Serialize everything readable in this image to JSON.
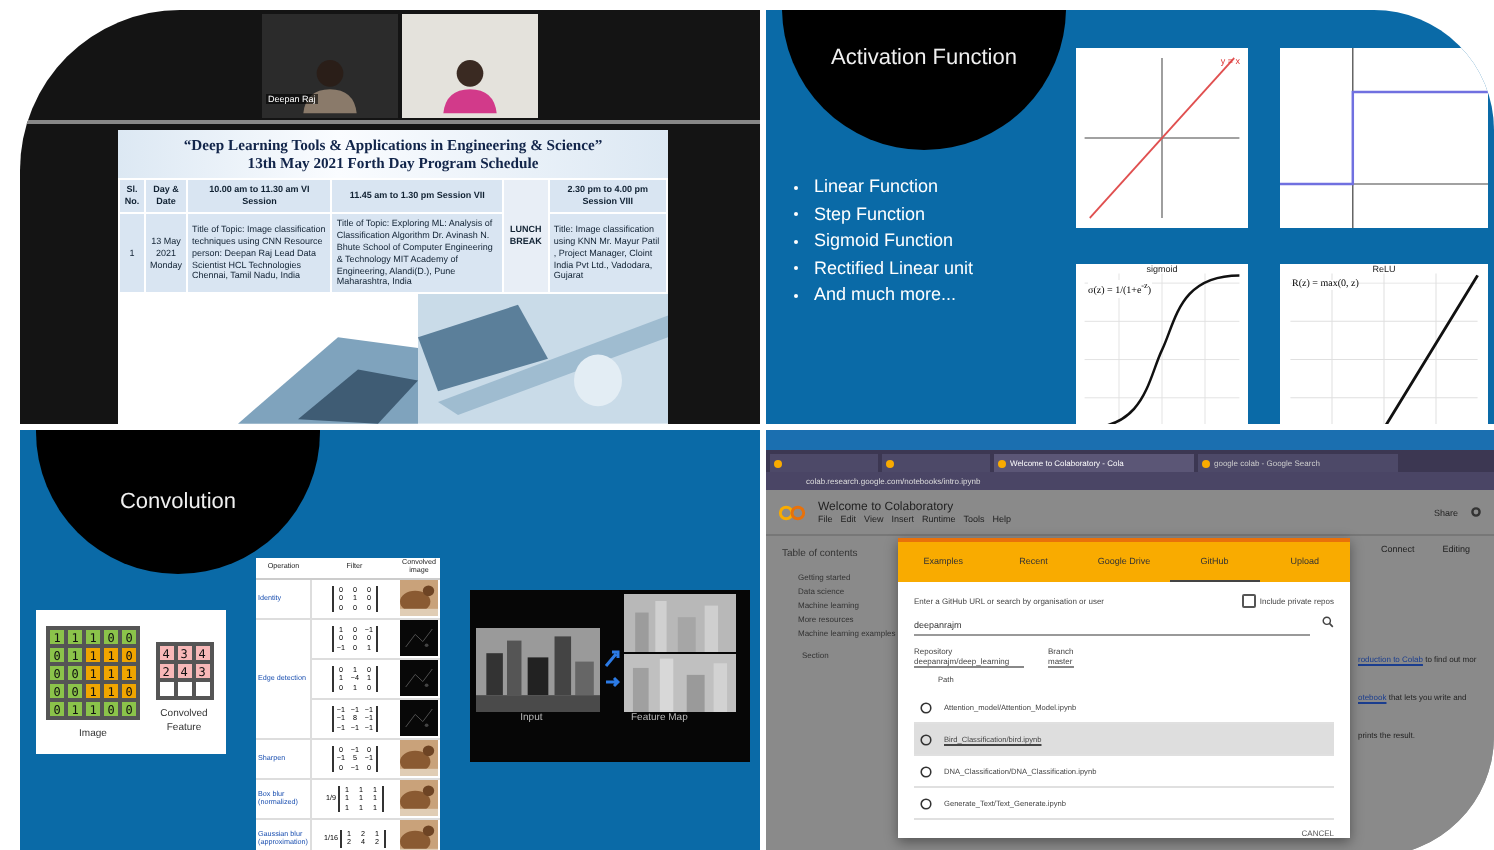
{
  "meeting": {
    "video_tiles": [
      {
        "name": "Deepan Raj",
        "kind": "dark"
      },
      {
        "kind": "light"
      }
    ],
    "schedule": {
      "title_lines": [
        "“Deep Learning Tools & Applications in  Engineering & Science”",
        "13th May 2021   Forth Day  Program Schedule"
      ],
      "columns": {
        "sl": "Sl. No.",
        "date": "Day & Date",
        "session_1": "10.00 am to 11.30 am VI Session",
        "session_2": "11.45 am to 1.30 pm  Session VII",
        "session_3": "2.30 pm to 4.00 pm Session VIII"
      },
      "rows": [
        {
          "sl": "1",
          "date": "13 May 2021 Monday",
          "session_1": "Title of Topic: Image classification techniques using CNN Resource person: Deepan Raj  Lead Data Scientist  HCL Technologies  Chennai, Tamil Nadu, India",
          "session_2": "Title of Topic: Exploring ML: Analysis of Classification Algorithm Dr. Avinash N. Bhute School of Computer Engineering & Technology MIT Academy of Engineering, Alandi(D.), Pune Maharashtra, India",
          "break": "LUNCH BREAK",
          "session_3": "Title:  Image classification using KNN Mr. Mayur Patil  , Project Manager, Cloint India Pvt Ltd., Vadodara, Gujarat"
        }
      ]
    }
  },
  "activation_slide": {
    "title": "Activation Function",
    "bullets": [
      "Linear Function",
      "Step Function",
      "Sigmoid Function",
      "Rectified Linear unit",
      "And much more..."
    ],
    "plots": [
      {
        "kind": "linear",
        "label": "y = x"
      },
      {
        "kind": "step"
      },
      {
        "kind": "sigmoid",
        "title": "sigmoid",
        "formula": "σ(z) = 1/(1+e$^{-z}$)"
      },
      {
        "kind": "relu",
        "title": "ReLU",
        "formula": "R(z) = max(0, z)"
      }
    ]
  },
  "convolution_slide": {
    "title": "Convolution",
    "image_matrix": [
      [
        {
          "value": "1",
          "highlighted": false
        },
        {
          "value": "1",
          "highlighted": false
        },
        {
          "value": "1",
          "highlighted": false
        },
        {
          "value": "0",
          "highlighted": false
        },
        {
          "value": "0",
          "highlighted": false
        }
      ],
      [
        {
          "value": "0",
          "highlighted": false
        },
        {
          "value": "1",
          "highlighted": false
        },
        {
          "value": "1",
          "highlighted": true
        },
        {
          "value": "1",
          "highlighted": true
        },
        {
          "value": "0",
          "highlighted": true
        }
      ],
      [
        {
          "value": "0",
          "highlighted": false
        },
        {
          "value": "0",
          "highlighted": false
        },
        {
          "value": "1",
          "highlighted": true
        },
        {
          "value": "1",
          "highlighted": true
        },
        {
          "value": "1",
          "highlighted": true
        }
      ],
      [
        {
          "value": "0",
          "highlighted": false
        },
        {
          "value": "0",
          "highlighted": false
        },
        {
          "value": "1",
          "highlighted": true
        },
        {
          "value": "1",
          "highlighted": true
        },
        {
          "value": "0",
          "highlighted": true
        }
      ],
      [
        {
          "value": "0",
          "highlighted": false
        },
        {
          "value": "1",
          "highlighted": false
        },
        {
          "value": "1",
          "highlighted": false
        },
        {
          "value": "0",
          "highlighted": false
        },
        {
          "value": "0",
          "highlighted": false
        }
      ]
    ],
    "image_label": "Image",
    "convolved": [
      [
        "4",
        "3",
        "4"
      ],
      [
        "2",
        "4",
        "3"
      ]
    ],
    "convolved_label": "Convolved Feature",
    "kernel_table": {
      "columns": [
        "Operation",
        "Filter",
        "Convolved image"
      ],
      "rows": [
        {
          "operation": "Identity",
          "filter": [
            [
              "0",
              "0",
              "0"
            ],
            [
              "0",
              "1",
              "0"
            ],
            [
              "0",
              "0",
              "0"
            ]
          ],
          "kind": "camel"
        },
        {
          "operation": "Edge detection",
          "filter": [
            [
              "1",
              "0",
              "−1"
            ],
            [
              "0",
              "0",
              "0"
            ],
            [
              "−1",
              "0",
              "1"
            ]
          ],
          "kind": "dark"
        },
        {
          "filter": [
            [
              "0",
              "1",
              "0"
            ],
            [
              "1",
              "−4",
              "1"
            ],
            [
              "0",
              "1",
              "0"
            ]
          ],
          "kind": "dark"
        },
        {
          "filter": [
            [
              "−1",
              "−1",
              "−1"
            ],
            [
              "−1",
              "8",
              "−1"
            ],
            [
              "−1",
              "−1",
              "−1"
            ]
          ],
          "kind": "dark"
        },
        {
          "operation": "Sharpen",
          "filter": [
            [
              "0",
              "−1",
              "0"
            ],
            [
              "−1",
              "5",
              "−1"
            ],
            [
              "0",
              "−1",
              "0"
            ]
          ],
          "kind": "camel"
        },
        {
          "operation": "Box blur (normalized)",
          "factor": "1/9",
          "filter": [
            [
              "1",
              "1",
              "1"
            ],
            [
              "1",
              "1",
              "1"
            ],
            [
              "1",
              "1",
              "1"
            ]
          ],
          "kind": "camel"
        },
        {
          "operation": "Gaussian blur (approximation)",
          "factor": "1/16",
          "filter": [
            [
              "1",
              "2",
              "1"
            ],
            [
              "2",
              "4",
              "2"
            ]
          ],
          "kind": "camel"
        }
      ]
    },
    "input_label": "Input",
    "feature_label": "Feature Map"
  },
  "colab": {
    "browser_tabs": [
      {
        "selected": false
      },
      {
        "selected": false
      },
      {
        "label": "Welcome to Colaboratory - Cola",
        "selected": true
      },
      {
        "label": "google colab - Google Search",
        "selected": false
      }
    ],
    "url": "colab.research.google.com/notebooks/intro.ipynb",
    "notebook_title": "Welcome to Colaboratory",
    "menu": [
      "File",
      "Edit",
      "View",
      "Insert",
      "Runtime",
      "Tools",
      "Help"
    ],
    "share": "Share",
    "connect": "Connect",
    "editing": "Editing",
    "toc_title": "Table of contents",
    "toc_items": [
      "Getting started",
      "Data science",
      "Machine learning",
      "More resources",
      "Machine learning examples"
    ],
    "toc_section": "Section",
    "page_lines": [
      {
        "link": "roduction to Colab",
        "rest": " to find out mor"
      },
      {
        "link": "otebook",
        "rest": " that lets you write and"
      },
      {
        "rest": "prints the result."
      }
    ],
    "dialog": {
      "tabs": [
        {
          "label": "Examples",
          "selected": false
        },
        {
          "label": "Recent",
          "selected": false
        },
        {
          "label": "Google Drive",
          "selected": false
        },
        {
          "label": "GitHub",
          "selected": true
        },
        {
          "label": "Upload",
          "selected": false
        }
      ],
      "prompt": "Enter a GitHub URL or search by organisation or user",
      "private_label": "Include private repos",
      "private_checked": false,
      "search_value": "deepanrajm",
      "repository_label": "Repository",
      "repository": "deepanrajm/deep_learning",
      "branch_label": "Branch",
      "branch": "master",
      "path_label": "Path",
      "files": [
        {
          "path": "Attention_model/Attention_Model.ipynb",
          "selected": false
        },
        {
          "path": "Bird_Classification/bird.ipynb",
          "selected": true
        },
        {
          "path": "DNA_Classification/DNA_Classification.ipynb",
          "selected": false
        },
        {
          "path": "Generate_Text/Text_Generate.ipynb",
          "selected": false
        }
      ],
      "cancel": "CANCEL"
    }
  }
}
